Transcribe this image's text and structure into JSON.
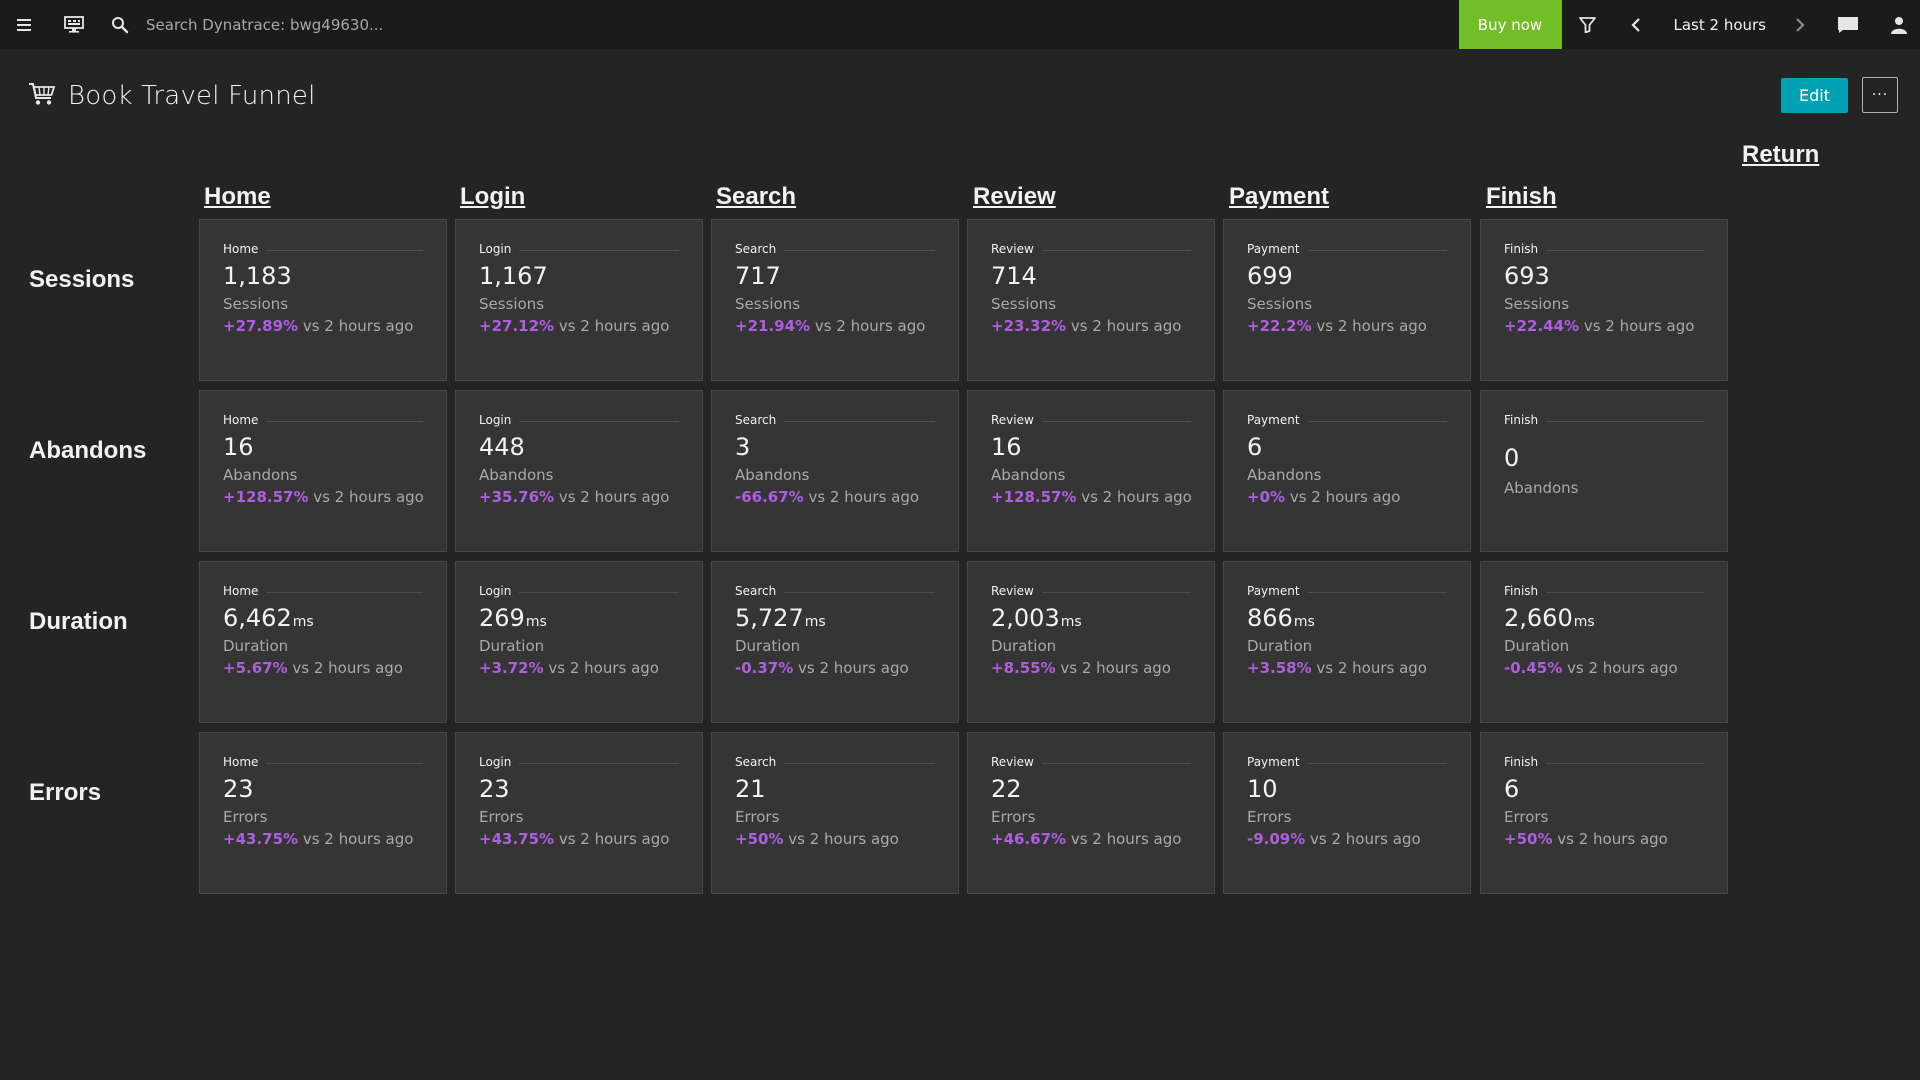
{
  "topbar": {
    "search_placeholder": "Search Dynatrace: bwg49630...",
    "buy_now_label": "Buy now",
    "timeframe_label": "Last 2 hours"
  },
  "page": {
    "title": "Book Travel Funnel",
    "edit_label": "Edit",
    "more_label": "···",
    "return_label": "Return"
  },
  "columns": [
    "Home",
    "Login",
    "Search",
    "Review",
    "Payment",
    "Finish"
  ],
  "comparison_text": "vs 2 hours ago",
  "rows": [
    {
      "label": "Sessions",
      "metric": "Sessions",
      "unit": "",
      "tiles": [
        {
          "name": "Home",
          "value": "1,183",
          "change": "+27.89%"
        },
        {
          "name": "Login",
          "value": "1,167",
          "change": "+27.12%"
        },
        {
          "name": "Search",
          "value": "717",
          "change": "+21.94%"
        },
        {
          "name": "Review",
          "value": "714",
          "change": "+23.32%"
        },
        {
          "name": "Payment",
          "value": "699",
          "change": "+22.2%"
        },
        {
          "name": "Finish",
          "value": "693",
          "change": "+22.44%"
        }
      ]
    },
    {
      "label": "Abandons",
      "metric": "Abandons",
      "unit": "",
      "tiles": [
        {
          "name": "Home",
          "value": "16",
          "change": "+128.57%"
        },
        {
          "name": "Login",
          "value": "448",
          "change": "+35.76%"
        },
        {
          "name": "Search",
          "value": "3",
          "change": "-66.67%"
        },
        {
          "name": "Review",
          "value": "16",
          "change": "+128.57%"
        },
        {
          "name": "Payment",
          "value": "6",
          "change": "+0%"
        },
        {
          "name": "Finish",
          "value": "0",
          "change": ""
        }
      ]
    },
    {
      "label": "Duration",
      "metric": "Duration",
      "unit": "ms",
      "tiles": [
        {
          "name": "Home",
          "value": "6,462",
          "change": "+5.67%"
        },
        {
          "name": "Login",
          "value": "269",
          "change": "+3.72%"
        },
        {
          "name": "Search",
          "value": "5,727",
          "change": "-0.37%"
        },
        {
          "name": "Review",
          "value": "2,003",
          "change": "+8.55%"
        },
        {
          "name": "Payment",
          "value": "866",
          "change": "+3.58%"
        },
        {
          "name": "Finish",
          "value": "2,660",
          "change": "-0.45%"
        }
      ]
    },
    {
      "label": "Errors",
      "metric": "Errors",
      "unit": "",
      "tiles": [
        {
          "name": "Home",
          "value": "23",
          "change": "+43.75%"
        },
        {
          "name": "Login",
          "value": "23",
          "change": "+43.75%"
        },
        {
          "name": "Search",
          "value": "21",
          "change": "+50%"
        },
        {
          "name": "Review",
          "value": "22",
          "change": "+46.67%"
        },
        {
          "name": "Payment",
          "value": "10",
          "change": "-9.09%"
        },
        {
          "name": "Finish",
          "value": "6",
          "change": "+50%"
        }
      ]
    }
  ],
  "colors": {
    "background": "#242424",
    "topbar": "#1b1b1b",
    "tile": "#353535",
    "buy_now": "#73be28",
    "edit": "#00a1b2",
    "change": "#b05ee0"
  },
  "icons": {
    "menu": "hamburger-menu-icon",
    "screen": "dashboard-screen-icon",
    "search": "search-icon",
    "filter": "filter-icon",
    "prev": "chevron-left-icon",
    "next": "chevron-right-icon",
    "chat": "chat-icon",
    "user": "user-icon",
    "cart": "shopping-cart-icon"
  }
}
